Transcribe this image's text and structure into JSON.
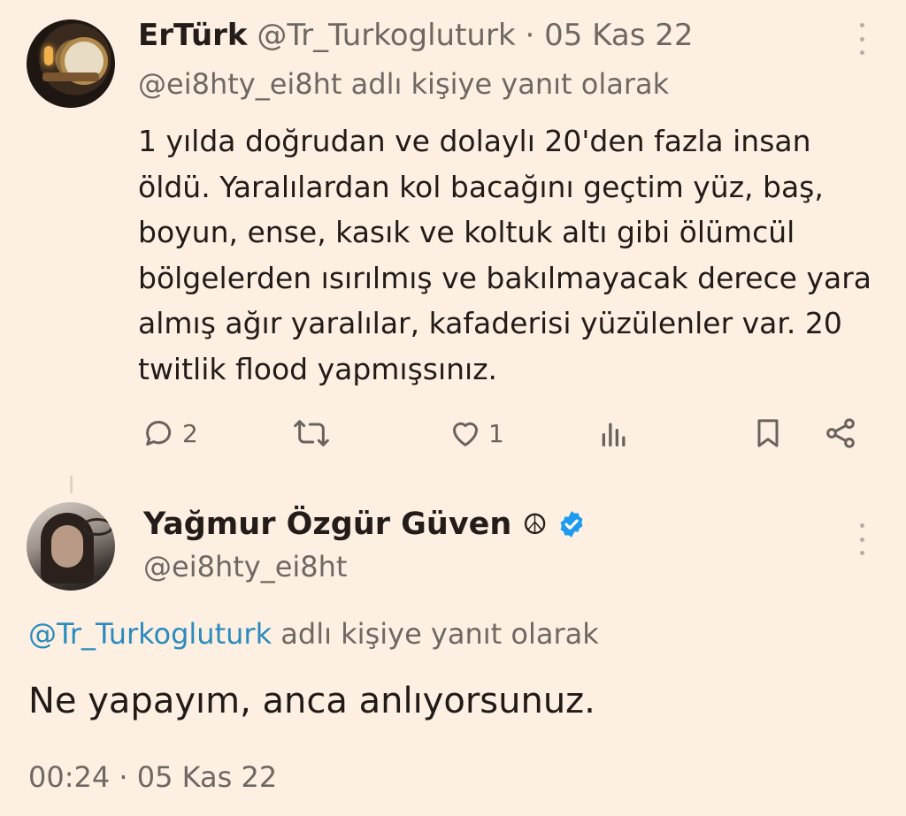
{
  "tweet1": {
    "display_name": "ErTürk",
    "handle": "@Tr_Turkogluturk",
    "separator": "·",
    "date": "05 Kas 22",
    "reply_to_handle": "@ei8hty_ei8ht",
    "reply_to_suffix": "adlı kişiye yanıt olarak",
    "body": "1 yılda doğrudan ve dolaylı 20'den fazla insan öldü. Yaralılardan kol bacağını geçtim yüz, baş, boyun, ense, kasık ve koltuk altı gibi ölümcül bölgelerden ısırılmış ve bakılmayacak derece yara almış ağır yaralılar, kafaderisi yüzülenler var. 20 twitlik flood yapmışsınız.",
    "actions": {
      "reply_count": "2",
      "retweet_count": "",
      "like_count": "1",
      "views_count": ""
    },
    "icons": [
      "reply-icon",
      "retweet-icon",
      "like-icon",
      "views-icon",
      "bookmark-icon",
      "share-icon",
      "more-icon"
    ]
  },
  "tweet2": {
    "display_name": "Yağmur Özgür Güven",
    "emoji": "☮",
    "verified": true,
    "handle": "@ei8hty_ei8ht",
    "reply_to_handle": "@Tr_Turkogluturk",
    "reply_to_suffix": "adlı kişiye yanıt olarak",
    "body": "Ne yapayım, anca anlıyorsunuz.",
    "time": "00:24",
    "separator": "·",
    "date": "05 Kas 22"
  },
  "colors": {
    "background": "#fdf0e3",
    "muted_text": "#6f6862",
    "link": "#2a8bbd",
    "verified": "#1d9bf0",
    "icon": "#6a625c"
  }
}
